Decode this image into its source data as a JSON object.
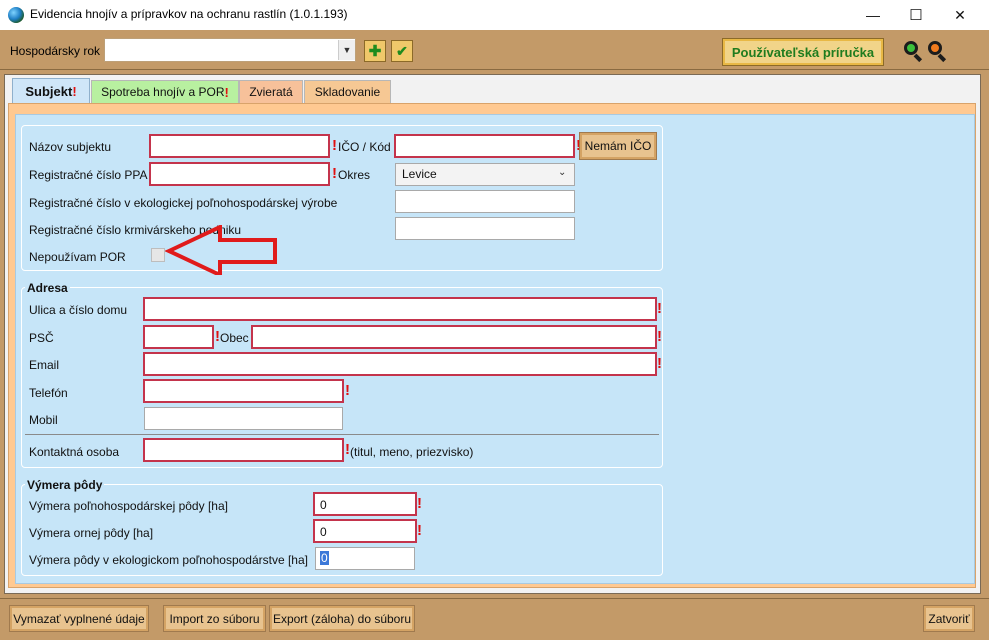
{
  "window": {
    "title": "Evidencia hnojív a prípravkov na ochranu rastlín (1.0.1.193)",
    "controls": {
      "minimize": "—",
      "maximize": "☐",
      "close": "✕"
    }
  },
  "toolbar": {
    "year_label": "Hospodársky rok",
    "year_value": "",
    "add_icon": "plus-icon",
    "confirm_icon": "check-icon",
    "manual_label": "Používateľská príručka",
    "zoom_in_icon": "zoom-in-icon",
    "zoom_out_icon": "zoom-out-icon"
  },
  "tabs": [
    {
      "label": "Subjekt",
      "required": "!"
    },
    {
      "label": "Spotreba hnojív a POR",
      "required": "!"
    },
    {
      "label": "Zvieratá"
    },
    {
      "label": "Skladovanie"
    }
  ],
  "subject": {
    "name_label": "Názov subjektu",
    "name_value": "",
    "ico_label": "IČO / Kód",
    "ico_value": "",
    "no_ico_button": "Nemám IČO",
    "ppa_label": "Registračné číslo PPA",
    "ppa_value": "",
    "okres_label": "Okres",
    "okres_value": "Levice",
    "eco_label": "Registračné číslo v ekologickej poľnohospodárskej výrobe",
    "eco_value": "",
    "feed_label": "Registračné číslo krmivárskeho podniku",
    "feed_value": "",
    "no_por_label": "Nepoužívam POR",
    "no_por_checked": false
  },
  "address": {
    "title": "Adresa",
    "street_label": "Ulica a číslo domu",
    "street_value": "",
    "psc_label": "PSČ",
    "psc_value": "",
    "obec_label": "Obec",
    "obec_value": "",
    "email_label": "Email",
    "email_value": "",
    "phone_label": "Telefón",
    "phone_value": "",
    "mobile_label": "Mobil",
    "mobile_value": "",
    "contact_label": "Kontaktná osoba",
    "contact_value": "",
    "contact_hint": "(titul, meno, priezvisko)"
  },
  "area": {
    "title": "Výmera pôdy",
    "agri_label": "Výmera poľnohospodárskej pôdy [ha]",
    "agri_value": "0",
    "arable_label": "Výmera ornej pôdy [ha]",
    "arable_value": "0",
    "eco_label": "Výmera pôdy v ekologickom poľnohospodárstve [ha]",
    "eco_value": "0"
  },
  "required_mark": "!",
  "bottom": {
    "clear_label": "Vymazať vyplnené údaje",
    "import_label": "Import zo súboru",
    "export_label": "Export (záloha) do súboru",
    "close_label": "Zatvoriť"
  },
  "colors": {
    "toolbar_bg": "#c39a68",
    "content_bg": "#c6e5f8",
    "required_border": "#c4344c",
    "arrow": "#e01b1b",
    "manual_text": "#1f7c1f"
  }
}
